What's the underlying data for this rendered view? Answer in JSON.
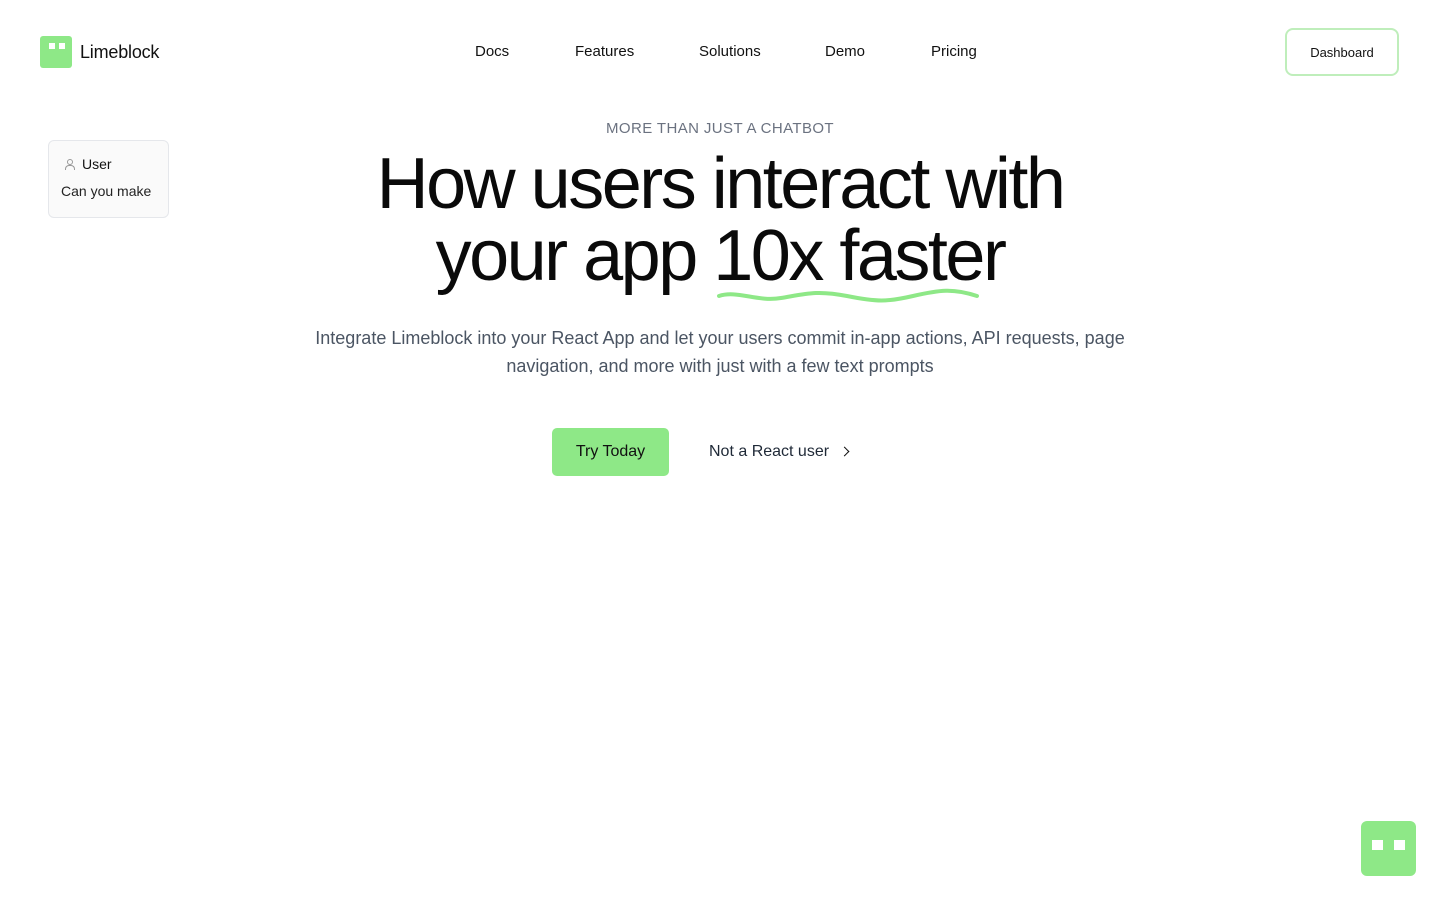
{
  "brand": {
    "name": "Limeblock",
    "accent_color": "#8ee887"
  },
  "nav": {
    "items": [
      {
        "label": "Docs"
      },
      {
        "label": "Features"
      },
      {
        "label": "Solutions"
      },
      {
        "label": "Demo"
      },
      {
        "label": "Pricing"
      }
    ],
    "dashboard_label": "Dashboard"
  },
  "chat_preview": {
    "sender": "User",
    "message": "Can you make",
    "icon": "user-icon"
  },
  "hero": {
    "eyebrow": "MORE THAN JUST A CHATBOT",
    "headline_line1": "How users interact with",
    "headline_line2_prefix": "your app ",
    "headline_highlight": "10x faster",
    "subtext": "Integrate Limeblock into your React App and let your users commit in-app actions, API requests, page navigation, and more with just with a few text prompts",
    "primary_cta": "Try Today",
    "secondary_cta": "Not a React user",
    "underline_color": "#8ee887"
  },
  "launcher": {
    "icon": "assistant-bot-icon"
  }
}
